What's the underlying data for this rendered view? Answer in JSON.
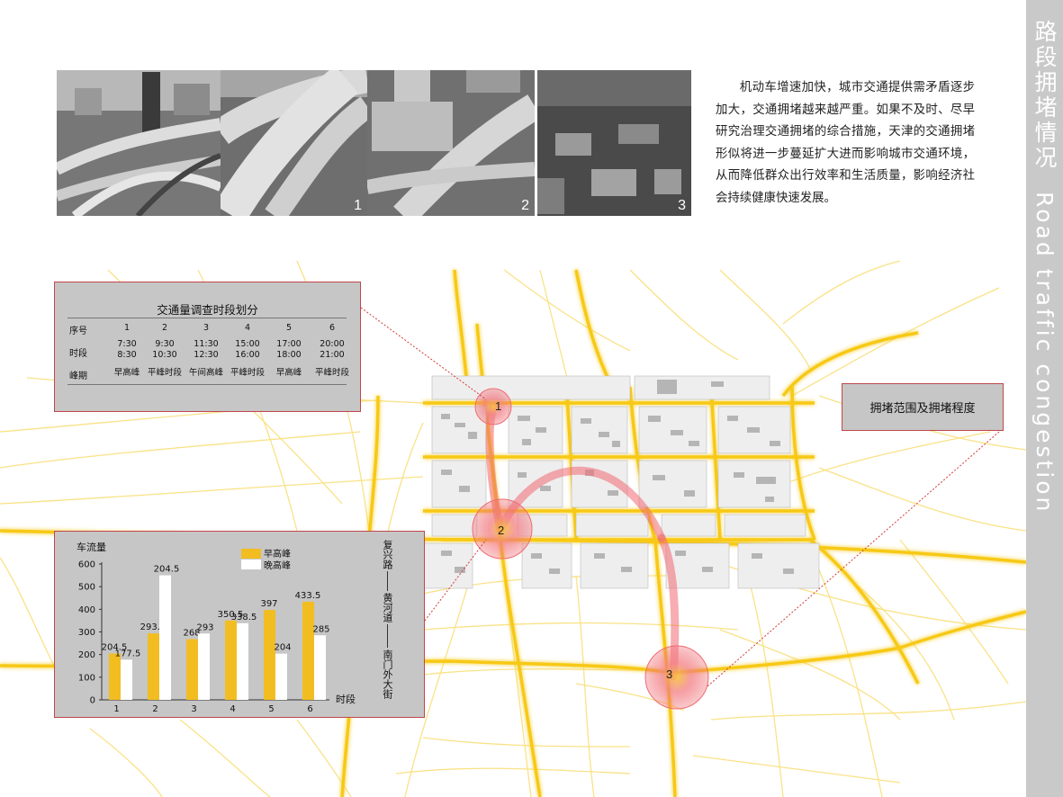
{
  "sidebar": {
    "title_cn": "路段拥堵情况",
    "title_en": "Road traffic congestion"
  },
  "photos": [
    {
      "number": ""
    },
    {
      "number": "1"
    },
    {
      "number": "2"
    },
    {
      "number": "3"
    }
  ],
  "intro_text": "机动车增速加快，城市交通提供需矛盾逐步加大，交通拥堵越来越严重。如果不及时、尽早研究治理交通拥堵的综合措施，天津的交通拥堵形似将进一步蔓延扩大进而影响城市交通环境，从而降低群众出行效率和生活质量，影响经济社会持续健康快速发展。",
  "schedule": {
    "title": "交通量调查时段划分",
    "row_labels": {
      "index": "序号",
      "time": "时段",
      "peak": "峰期"
    },
    "columns": [
      {
        "index": "1",
        "start": "7:30",
        "end": "8:30",
        "peak": "早高峰"
      },
      {
        "index": "2",
        "start": "9:30",
        "end": "10:30",
        "peak": "平峰时段"
      },
      {
        "index": "3",
        "start": "11:30",
        "end": "12:30",
        "peak": "午间高峰"
      },
      {
        "index": "4",
        "start": "15:00",
        "end": "16:00",
        "peak": "平峰时段"
      },
      {
        "index": "5",
        "start": "17:00",
        "end": "18:00",
        "peak": "早高峰"
      },
      {
        "index": "6",
        "start": "20:00",
        "end": "21:00",
        "peak": "平峰时段"
      }
    ]
  },
  "congestion_label": "拥堵范围及拥堵程度",
  "map_markers": [
    "1",
    "2",
    "3"
  ],
  "road_label": {
    "seg1": "复兴路",
    "seg2": "黄河道",
    "seg3": "南门外大街"
  },
  "colors": {
    "morning": "#f2bd21",
    "evening": "#ffffff",
    "road": "#f7c915",
    "hotspot": "#f06a72",
    "panel": "#c6c6c6",
    "sidebar": "#c9c9c9"
  },
  "chart_data": {
    "type": "bar",
    "ylabel": "车流量",
    "xlabel": "时段",
    "ylim": [
      0,
      600
    ],
    "yticks": [
      0,
      100,
      200,
      300,
      400,
      500,
      600
    ],
    "categories": [
      "1",
      "2",
      "3",
      "4",
      "5",
      "6"
    ],
    "series": [
      {
        "name": "早高峰",
        "values": [
          204.5,
          293.5,
          268,
          350.5,
          397,
          433.5
        ],
        "labels": [
          "204.5",
          "293.5",
          "268",
          "350.5",
          "397",
          "433.5"
        ]
      },
      {
        "name": "晚高峰",
        "values": [
          177.5,
          550,
          293,
          338.5,
          204,
          285
        ],
        "labels": [
          "177.5",
          "204.5",
          "293",
          "338.5",
          "204",
          "285"
        ]
      }
    ],
    "legend_position": "top-center",
    "grid": false
  }
}
